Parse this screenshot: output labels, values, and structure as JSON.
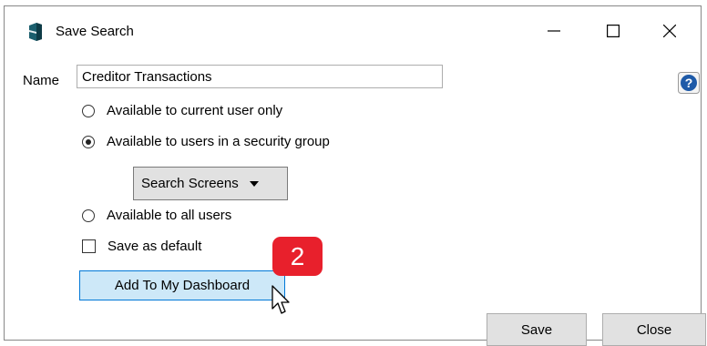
{
  "window": {
    "title": "Save Search",
    "icon": "database-icon",
    "controls": {
      "minimize": "minimize-icon",
      "maximize": "maximize-icon",
      "close": "close-icon"
    }
  },
  "form": {
    "name_label": "Name",
    "name_value": "Creditor Transactions",
    "help_icon": "help-icon",
    "options": [
      {
        "label": "Available to current user only",
        "checked": false
      },
      {
        "label": "Available to users in a security group",
        "checked": true
      },
      {
        "label": "Available to all users",
        "checked": false
      }
    ],
    "security_group": {
      "selected": "Search Screens"
    },
    "save_default": {
      "label": "Save as default",
      "checked": false
    },
    "dashboard_button": "Add To My Dashboard"
  },
  "annotation": {
    "step_number": "2",
    "color": "#e8202c"
  },
  "buttons": {
    "save": "Save",
    "close": "Close"
  }
}
